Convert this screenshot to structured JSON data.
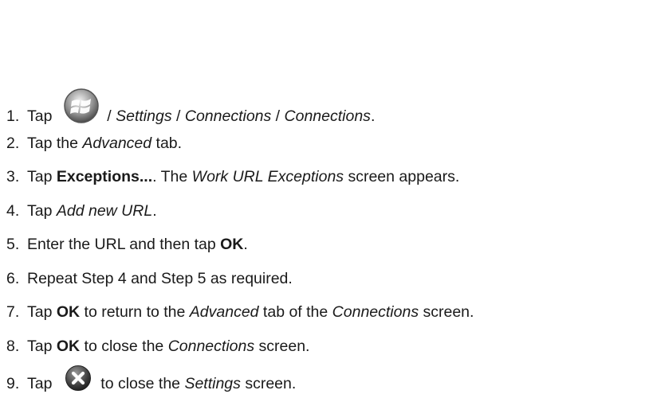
{
  "steps": [
    {
      "num": "1.",
      "parts": [
        {
          "t": "Tap "
        },
        {
          "icon": "windows-start-icon"
        },
        {
          "t": " / "
        },
        {
          "t": "Settings",
          "s": "i"
        },
        {
          "t": " / "
        },
        {
          "t": "Connections",
          "s": "i"
        },
        {
          "t": " / "
        },
        {
          "t": "Connections",
          "s": "i"
        },
        {
          "t": "."
        }
      ]
    },
    {
      "num": "2.",
      "parts": [
        {
          "t": "Tap the "
        },
        {
          "t": "Advanced",
          "s": "i"
        },
        {
          "t": " tab."
        }
      ]
    },
    {
      "num": "3.",
      "parts": [
        {
          "t": "Tap "
        },
        {
          "t": "Exceptions...",
          "s": "b"
        },
        {
          "t": ". The "
        },
        {
          "t": "Work URL Exceptions",
          "s": "i"
        },
        {
          "t": " screen appears."
        }
      ]
    },
    {
      "num": "4.",
      "parts": [
        {
          "t": "Tap "
        },
        {
          "t": "Add new URL",
          "s": "i"
        },
        {
          "t": "."
        }
      ]
    },
    {
      "num": "5.",
      "parts": [
        {
          "t": "Enter the URL and then tap "
        },
        {
          "t": "OK",
          "s": "b"
        },
        {
          "t": "."
        }
      ]
    },
    {
      "num": "6.",
      "parts": [
        {
          "t": "Repeat Step 4 and Step 5 as required."
        }
      ]
    },
    {
      "num": "7.",
      "parts": [
        {
          "t": "Tap "
        },
        {
          "t": "OK",
          "s": "b"
        },
        {
          "t": " to return to the "
        },
        {
          "t": "Advanced",
          "s": "i"
        },
        {
          "t": " tab of the "
        },
        {
          "t": "Connections",
          "s": "i"
        },
        {
          "t": " screen."
        }
      ]
    },
    {
      "num": "8.",
      "parts": [
        {
          "t": "Tap "
        },
        {
          "t": "OK",
          "s": "b"
        },
        {
          "t": " to close the "
        },
        {
          "t": "Connections",
          "s": "i"
        },
        {
          "t": " screen."
        }
      ]
    },
    {
      "num": "9.",
      "parts": [
        {
          "t": "Tap "
        },
        {
          "icon": "close-icon"
        },
        {
          "t": " to close the "
        },
        {
          "t": "Settings",
          "s": "i"
        },
        {
          "t": " screen."
        }
      ]
    }
  ]
}
